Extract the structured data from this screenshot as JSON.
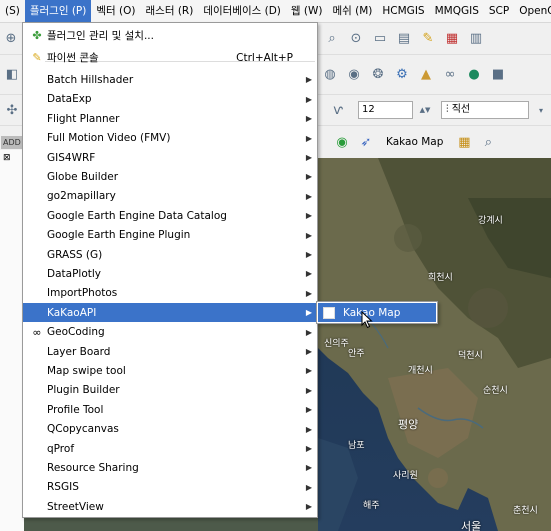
{
  "menubar": {
    "items": [
      {
        "label": "(S)"
      },
      {
        "label": "플러그인 (P)",
        "active": true
      },
      {
        "label": "벡터 (O)"
      },
      {
        "label": "래스터 (R)"
      },
      {
        "label": "데이터베이스 (D)"
      },
      {
        "label": "웹 (W)"
      },
      {
        "label": "메쉬 (M)"
      },
      {
        "label": "HCMGIS"
      },
      {
        "label": "MMQGIS"
      },
      {
        "label": "SCP"
      },
      {
        "label": "OpenQ"
      }
    ]
  },
  "toolbar": {
    "font_size_value": "12",
    "style_select": "직선",
    "kakao_map_label": "Kakao Map",
    "left_fragment": "ADD"
  },
  "plugins_menu": {
    "items": [
      {
        "label": "플러그인 관리 및 설치...",
        "shortcut": "",
        "icon": "puzzle-icon",
        "submenu": false
      },
      {
        "label": "파이썬 콘솔",
        "shortcut": "Ctrl+Alt+P",
        "icon": "python-icon",
        "submenu": false
      },
      {
        "label": "Batch Hillshader",
        "shortcut": "",
        "icon": "",
        "submenu": true
      },
      {
        "label": "DataExp",
        "shortcut": "",
        "icon": "",
        "submenu": true
      },
      {
        "label": "Flight Planner",
        "shortcut": "",
        "icon": "",
        "submenu": true
      },
      {
        "label": "Full Motion Video (FMV)",
        "shortcut": "",
        "icon": "",
        "submenu": true
      },
      {
        "label": "GIS4WRF",
        "shortcut": "",
        "icon": "",
        "submenu": true
      },
      {
        "label": "Globe Builder",
        "shortcut": "",
        "icon": "",
        "submenu": true
      },
      {
        "label": "go2mapillary",
        "shortcut": "",
        "icon": "",
        "submenu": true
      },
      {
        "label": "Google Earth Engine Data Catalog",
        "shortcut": "",
        "icon": "",
        "submenu": true
      },
      {
        "label": "Google Earth Engine Plugin",
        "shortcut": "",
        "icon": "",
        "submenu": true
      },
      {
        "label": "GRASS (G)",
        "shortcut": "",
        "icon": "",
        "submenu": true
      },
      {
        "label": "DataPlotly",
        "shortcut": "",
        "icon": "",
        "submenu": true
      },
      {
        "label": "ImportPhotos",
        "shortcut": "",
        "icon": "",
        "submenu": true
      },
      {
        "label": "KaKaoAPI",
        "shortcut": "",
        "icon": "",
        "submenu": true,
        "highlighted": true
      },
      {
        "label": "GeoCoding",
        "shortcut": "",
        "icon": "binoculars-icon",
        "submenu": true
      },
      {
        "label": "Layer Board",
        "shortcut": "",
        "icon": "",
        "submenu": true
      },
      {
        "label": "Map swipe tool",
        "shortcut": "",
        "icon": "",
        "submenu": true
      },
      {
        "label": "Plugin Builder",
        "shortcut": "",
        "icon": "",
        "submenu": true
      },
      {
        "label": "Profile Tool",
        "shortcut": "",
        "icon": "",
        "submenu": true
      },
      {
        "label": "QCopycanvas",
        "shortcut": "",
        "icon": "",
        "submenu": true
      },
      {
        "label": "qProf",
        "shortcut": "",
        "icon": "",
        "submenu": true
      },
      {
        "label": "Resource Sharing",
        "shortcut": "",
        "icon": "",
        "submenu": true
      },
      {
        "label": "RSGIS",
        "shortcut": "",
        "icon": "",
        "submenu": true
      },
      {
        "label": "StreetView",
        "shortcut": "",
        "icon": "",
        "submenu": true
      }
    ]
  },
  "kakao_submenu": {
    "items": [
      {
        "label": "Kakao Map"
      }
    ]
  },
  "map_labels": [
    {
      "text": "신의주"
    },
    {
      "text": "평양"
    },
    {
      "text": "안주"
    },
    {
      "text": "희천시"
    },
    {
      "text": "덕천시"
    },
    {
      "text": "개천시"
    },
    {
      "text": "남포"
    },
    {
      "text": "사리원"
    },
    {
      "text": "해주"
    },
    {
      "text": "서울"
    },
    {
      "text": "춘천시"
    },
    {
      "text": "강계시"
    },
    {
      "text": "순천시"
    }
  ],
  "colors": {
    "highlight": "#3b73c9",
    "menu_bg": "#ffffff"
  }
}
